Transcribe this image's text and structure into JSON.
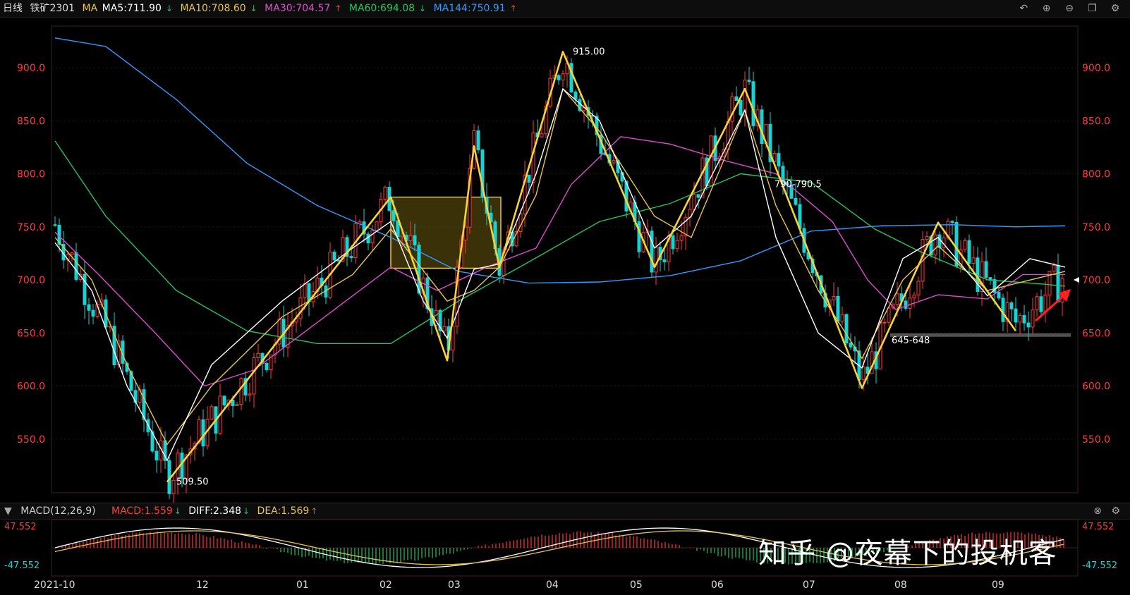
{
  "header": {
    "period": "日线",
    "instrument": "铁矿2301",
    "ma_prefix": "MA",
    "ma5": "MA5:711.90",
    "ma10": "MA10:708.60",
    "ma30": "MA30:704.57",
    "ma60": "MA60:694.08",
    "ma144": "MA144:750.91",
    "tools": [
      "undo-icon",
      "zoom-in-icon",
      "zoom-out-icon",
      "window-icon",
      "settings-icon"
    ]
  },
  "macd_header": {
    "name": "MACD(12,26,9)",
    "macd": "MACD:1.559",
    "diff": "DIFF:2.348",
    "dea": "DEA:1.569",
    "macd_top_label": "47.552",
    "macd_bottom_label": "-47.552"
  },
  "colors": {
    "up": "#ff3b3b",
    "down": "#19d2d2",
    "ma5": "#ffffff",
    "ma10": "#e8c44a",
    "ma30": "#e14bd0",
    "ma60": "#22c55e",
    "ma144": "#2f9bff",
    "zigzag": "#f6d33b",
    "grid": "#2a1414"
  },
  "watermark": "知乎 @夜幕下的投机客",
  "chart_data": {
    "type": "candlestick",
    "ylim": [
      500,
      935
    ],
    "y_ticks": [
      "900.0",
      "850.0",
      "800.0",
      "750.0",
      "700.0",
      "650.0",
      "600.0",
      "550.0"
    ],
    "x_ticks": [
      "2021-10",
      "12",
      "01",
      "02",
      "03",
      "04",
      "05",
      "06",
      "07",
      "08",
      "09"
    ],
    "annotations": [
      "915.00",
      "509.50",
      "790-790.5",
      "645-648"
    ],
    "zigzag_points": [
      [
        510,
        509.5
      ],
      [
        635,
        778
      ],
      [
        700,
        624
      ],
      [
        722,
        826
      ],
      [
        745,
        712
      ],
      [
        812,
        915
      ],
      [
        908,
        712
      ],
      [
        986,
        880
      ],
      [
        1150,
        598
      ],
      [
        1274,
        754
      ],
      [
        1360,
        652
      ]
    ],
    "box": {
      "price_top": 778,
      "price_bottom": 711
    },
    "support_line": 648,
    "current_price": 700,
    "series": [
      {
        "name": "MA5",
        "last": 711.9
      },
      {
        "name": "MA10",
        "last": 708.6
      },
      {
        "name": "MA30",
        "last": 704.57
      },
      {
        "name": "MA60",
        "last": 694.08
      },
      {
        "name": "MA144",
        "last": 750.91
      }
    ]
  }
}
